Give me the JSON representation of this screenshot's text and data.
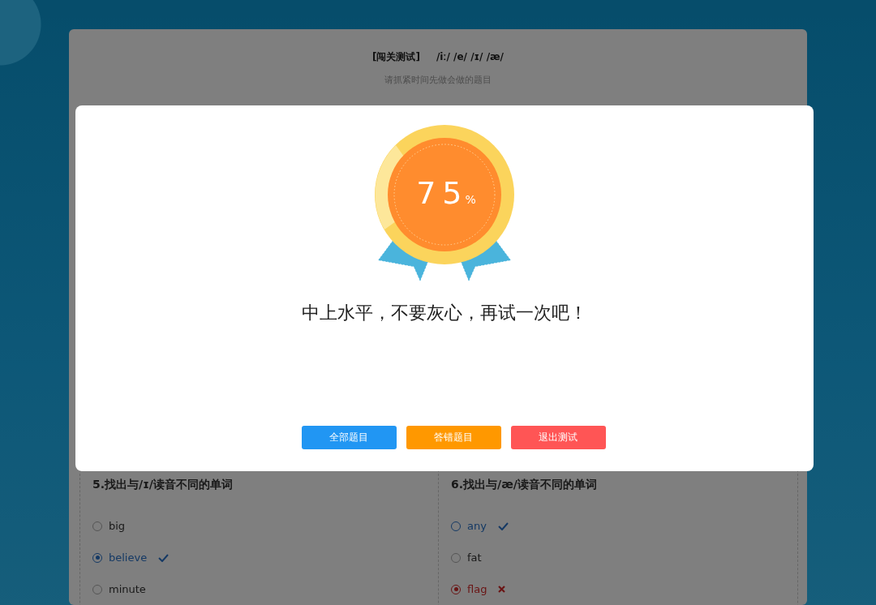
{
  "quiz": {
    "title": "[闯关测试]",
    "phonetics": "/iː/ /e/ /ɪ/ /æ/",
    "subtitle": "请抓紧时间先做会做的题目"
  },
  "questions": [
    {
      "title": "5.找出与/ɪ/读音不同的单词",
      "options": [
        {
          "label": "big",
          "selected": false,
          "correct": false
        },
        {
          "label": "believe",
          "selected": true,
          "correct": true
        },
        {
          "label": "minute",
          "selected": false,
          "correct": false
        }
      ]
    },
    {
      "title": "6.找出与/æ/读音不同的单词",
      "options": [
        {
          "label": "any",
          "selected": false,
          "correct": true
        },
        {
          "label": "fat",
          "selected": false,
          "correct": false
        },
        {
          "label": "flag",
          "selected": true,
          "correct": false
        }
      ]
    }
  ],
  "result_dialog": {
    "score": "75",
    "unit": "%",
    "message": "中上水平，不要灰心，再试一次吧！",
    "buttons": [
      {
        "label": "全部题目",
        "kind": "all"
      },
      {
        "label": "答错题目",
        "kind": "wrong"
      },
      {
        "label": "退出测试",
        "kind": "exit"
      }
    ]
  }
}
